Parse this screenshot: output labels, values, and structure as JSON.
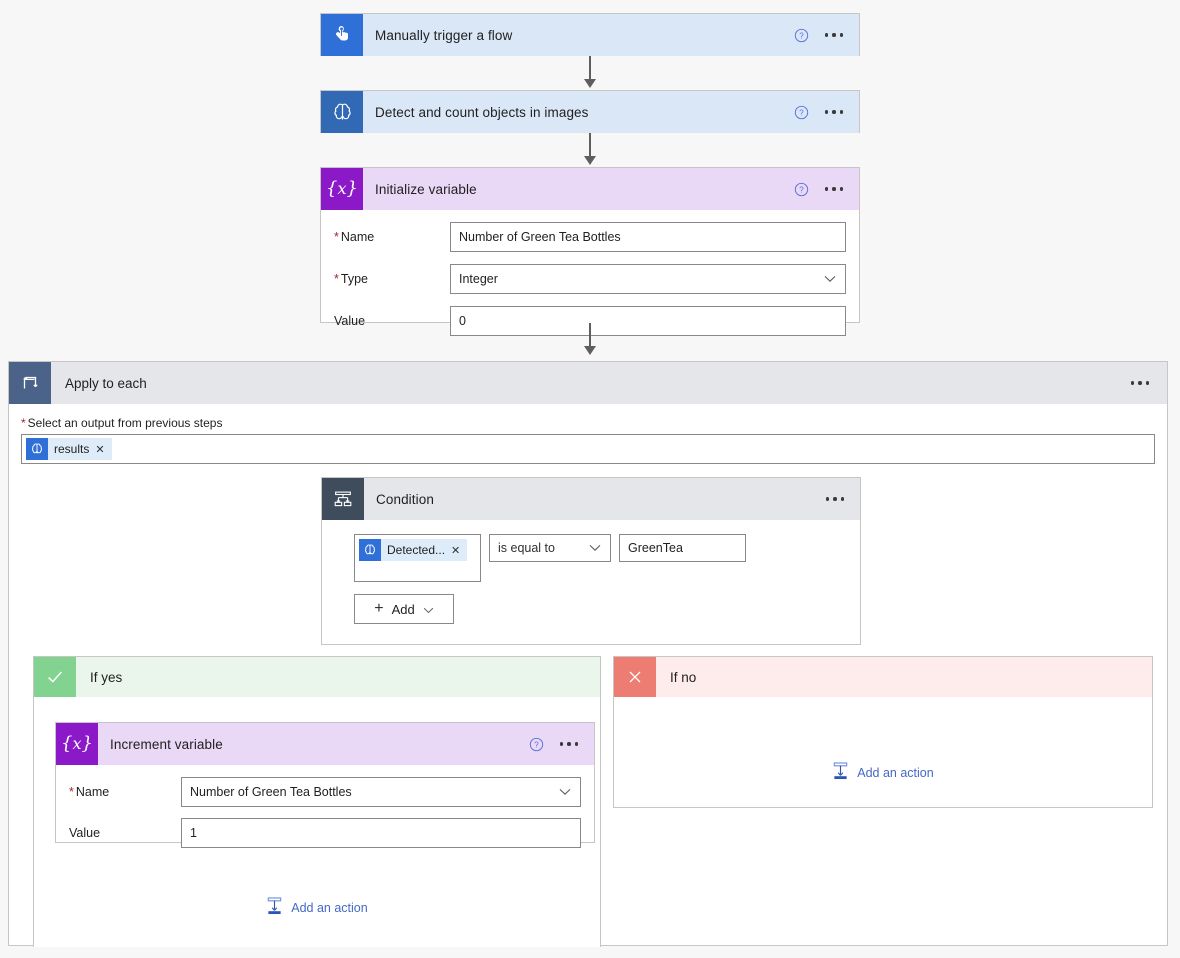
{
  "flow": {
    "trigger": {
      "title": "Manually trigger a flow",
      "icon": "tap-hand-icon",
      "help_icon": "help-circle-icon",
      "menu_icon": "more-options-icon"
    },
    "detect_action": {
      "title": "Detect and count objects in images",
      "icon": "ai-builder-brain-icon",
      "help_icon": "help-circle-icon",
      "menu_icon": "more-options-icon"
    },
    "initialize_variable": {
      "title": "Initialize variable",
      "icon": "variable-braces-icon",
      "help_icon": "help-circle-icon",
      "menu_icon": "more-options-icon",
      "fields": [
        {
          "label": "Name",
          "required": true,
          "value": "Number of Green Tea Bottles",
          "type": "text"
        },
        {
          "label": "Type",
          "required": true,
          "value": "Integer",
          "type": "select"
        },
        {
          "label": "Value",
          "required": false,
          "value": "0",
          "type": "text"
        }
      ]
    },
    "apply_to_each": {
      "title": "Apply to each",
      "icon": "loop-icon",
      "menu_icon": "more-options-icon",
      "output_label": "Select an output from previous steps",
      "output_required": true,
      "token": {
        "text": "results",
        "icon": "ai-builder-brain-icon",
        "remove_icon": "close-x-icon"
      }
    },
    "condition": {
      "title": "Condition",
      "icon": "condition-branch-icon",
      "menu_icon": "more-options-icon",
      "left_operand": {
        "text": "Detected...",
        "icon": "ai-builder-brain-icon",
        "remove_icon": "close-x-icon"
      },
      "operator": "is equal to",
      "right_operand": "GreenTea",
      "add_button": "Add",
      "add_icon": "plus-icon",
      "add_chevron_icon": "chevron-down-icon"
    },
    "if_yes": {
      "title": "If yes",
      "icon": "checkmark-icon",
      "add_action_label": "Add an action",
      "add_action_icon": "add-action-icon",
      "increment_variable": {
        "title": "Increment variable",
        "icon": "variable-braces-icon",
        "help_icon": "help-circle-icon",
        "menu_icon": "more-options-icon",
        "fields": [
          {
            "label": "Name",
            "required": true,
            "value": "Number of Green Tea Bottles",
            "type": "select"
          },
          {
            "label": "Value",
            "required": false,
            "value": "1",
            "type": "text"
          }
        ]
      }
    },
    "if_no": {
      "title": "If no",
      "icon": "close-x-icon",
      "add_action_label": "Add an action",
      "add_action_icon": "add-action-icon"
    }
  },
  "colors": {
    "trigger_tile": "#2f6fd8",
    "ai_tile": "#3169b5",
    "variable_tile": "#8c19c8",
    "condition_tile": "#3e4c5c",
    "loop_tile": "#4c6389",
    "yes_tile": "#81d38f",
    "no_tile": "#ed7d72",
    "header_blue": "#dae7f7",
    "header_purple": "#e9d8f6",
    "header_gray": "#e5e6ea",
    "link_blue": "#4668c5",
    "required_red": "#a4262c"
  }
}
